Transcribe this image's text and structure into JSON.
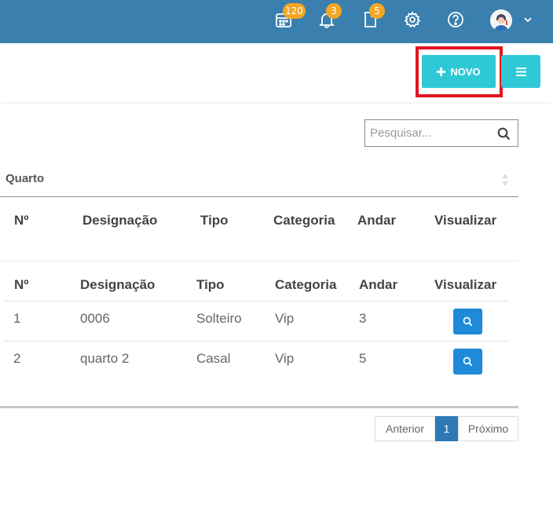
{
  "topbar": {
    "calendar_badge": "120",
    "notifications_badge": "3",
    "documents_badge": "5",
    "colors": {
      "bar": "#3a7fae",
      "badge": "#f5a623"
    }
  },
  "actions": {
    "new_label": "NOVO",
    "new_icon": "plus-icon",
    "menu_icon": "hamburger-icon",
    "accent": "#2fc9d6"
  },
  "search": {
    "placeholder": "Pesquisar...",
    "value": ""
  },
  "section": {
    "title": "Quarto"
  },
  "table": {
    "columns": [
      "Nº",
      "Designação",
      "Tipo",
      "Categoria",
      "Andar",
      "Visualizar"
    ],
    "rows": [
      {
        "num": "1",
        "designacao": "0006",
        "tipo": "Solteiro",
        "categoria": "Vip",
        "andar": "3"
      },
      {
        "num": "2",
        "designacao": "quarto 2",
        "tipo": "Casal",
        "categoria": "Vip",
        "andar": "5"
      }
    ]
  },
  "pagination": {
    "prev": "Anterior",
    "current": "1",
    "next": "Próximo"
  }
}
